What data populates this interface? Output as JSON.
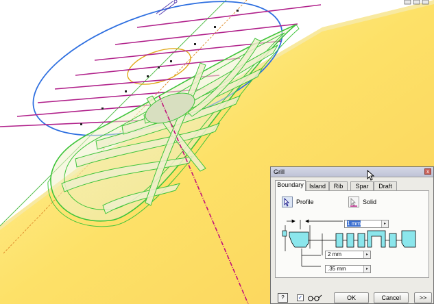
{
  "dialog": {
    "title": "Grill",
    "close_glyph": "x",
    "tabs": [
      "Boundary",
      "Island",
      "Rib",
      "Spar",
      "Draft"
    ],
    "active_tab": "Boundary",
    "profile_label": "Profile",
    "solid_label": "Solid",
    "fields": {
      "height": "1 mm",
      "thickness": "2 mm",
      "offset": ".35 mm"
    },
    "help_glyph": "?",
    "preview_checked": true,
    "ok_label": "OK",
    "cancel_label": "Cancel",
    "more_label": ">>"
  },
  "colors": {
    "titlebar": "#c4c7d9",
    "viewport_top": "#ffffff",
    "part_face": "#fde168",
    "grill_edge": "#3ec43a",
    "sketch_circle": "#2e6fe0",
    "sketch_lines": "#b0208a",
    "axis_dashed": "#c0107a",
    "inner_ellipse": "#e0a818",
    "preview_fill": "#8be6ec",
    "selection": "#3a6fd0"
  },
  "icons": [
    "cursor-select-icon",
    "solid-select-icon",
    "help-icon",
    "glasses-icon",
    "close-icon",
    "dropdown-arrow-icon",
    "mouse-pointer-icon",
    "window-minimize-icon",
    "window-restore-icon",
    "window-close-icon"
  ]
}
